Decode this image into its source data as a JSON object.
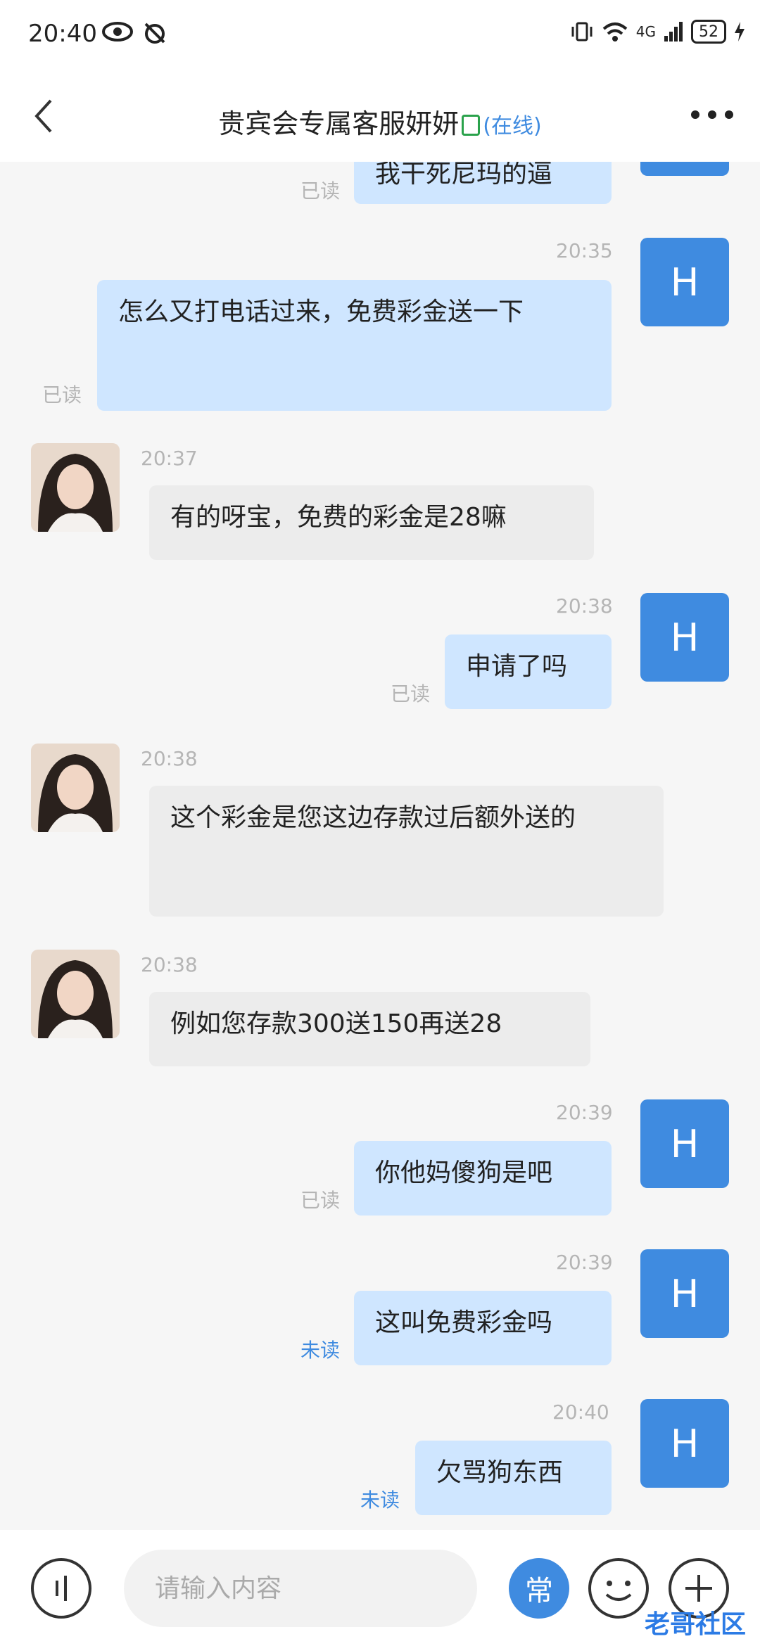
{
  "status": {
    "time": "20:40",
    "network": "4G",
    "battery": "52"
  },
  "header": {
    "title": "贵宾会专属客服妍妍",
    "online": "(在线)"
  },
  "messages": [
    {
      "dir": "out",
      "text": "我干死尼玛的逼",
      "read": "已读"
    },
    {
      "dir": "out",
      "time": "20:35",
      "text": "怎么又打电话过来，免费彩金送一下",
      "read": "已读",
      "avatar": "H"
    },
    {
      "dir": "in",
      "time": "20:37",
      "text": "有的呀宝，免费的彩金是28嘛"
    },
    {
      "dir": "out",
      "time": "20:38",
      "text": "申请了吗",
      "read": "已读",
      "avatar": "H"
    },
    {
      "dir": "in",
      "time": "20:38",
      "text": "这个彩金是您这边存款过后额外送的"
    },
    {
      "dir": "in",
      "time": "20:38",
      "text": "例如您存款300送150再送28"
    },
    {
      "dir": "out",
      "time": "20:39",
      "text": "你他妈傻狗是吧",
      "read": "已读",
      "avatar": "H"
    },
    {
      "dir": "out",
      "time": "20:39",
      "text": "这叫免费彩金吗",
      "read": "未读",
      "avatar": "H"
    },
    {
      "dir": "out",
      "time": "20:40",
      "text": "欠骂狗东西",
      "read": "未读",
      "avatar": "H"
    }
  ],
  "input": {
    "placeholder": "请输入内容",
    "common_label": "常"
  },
  "watermark": "老哥社区"
}
